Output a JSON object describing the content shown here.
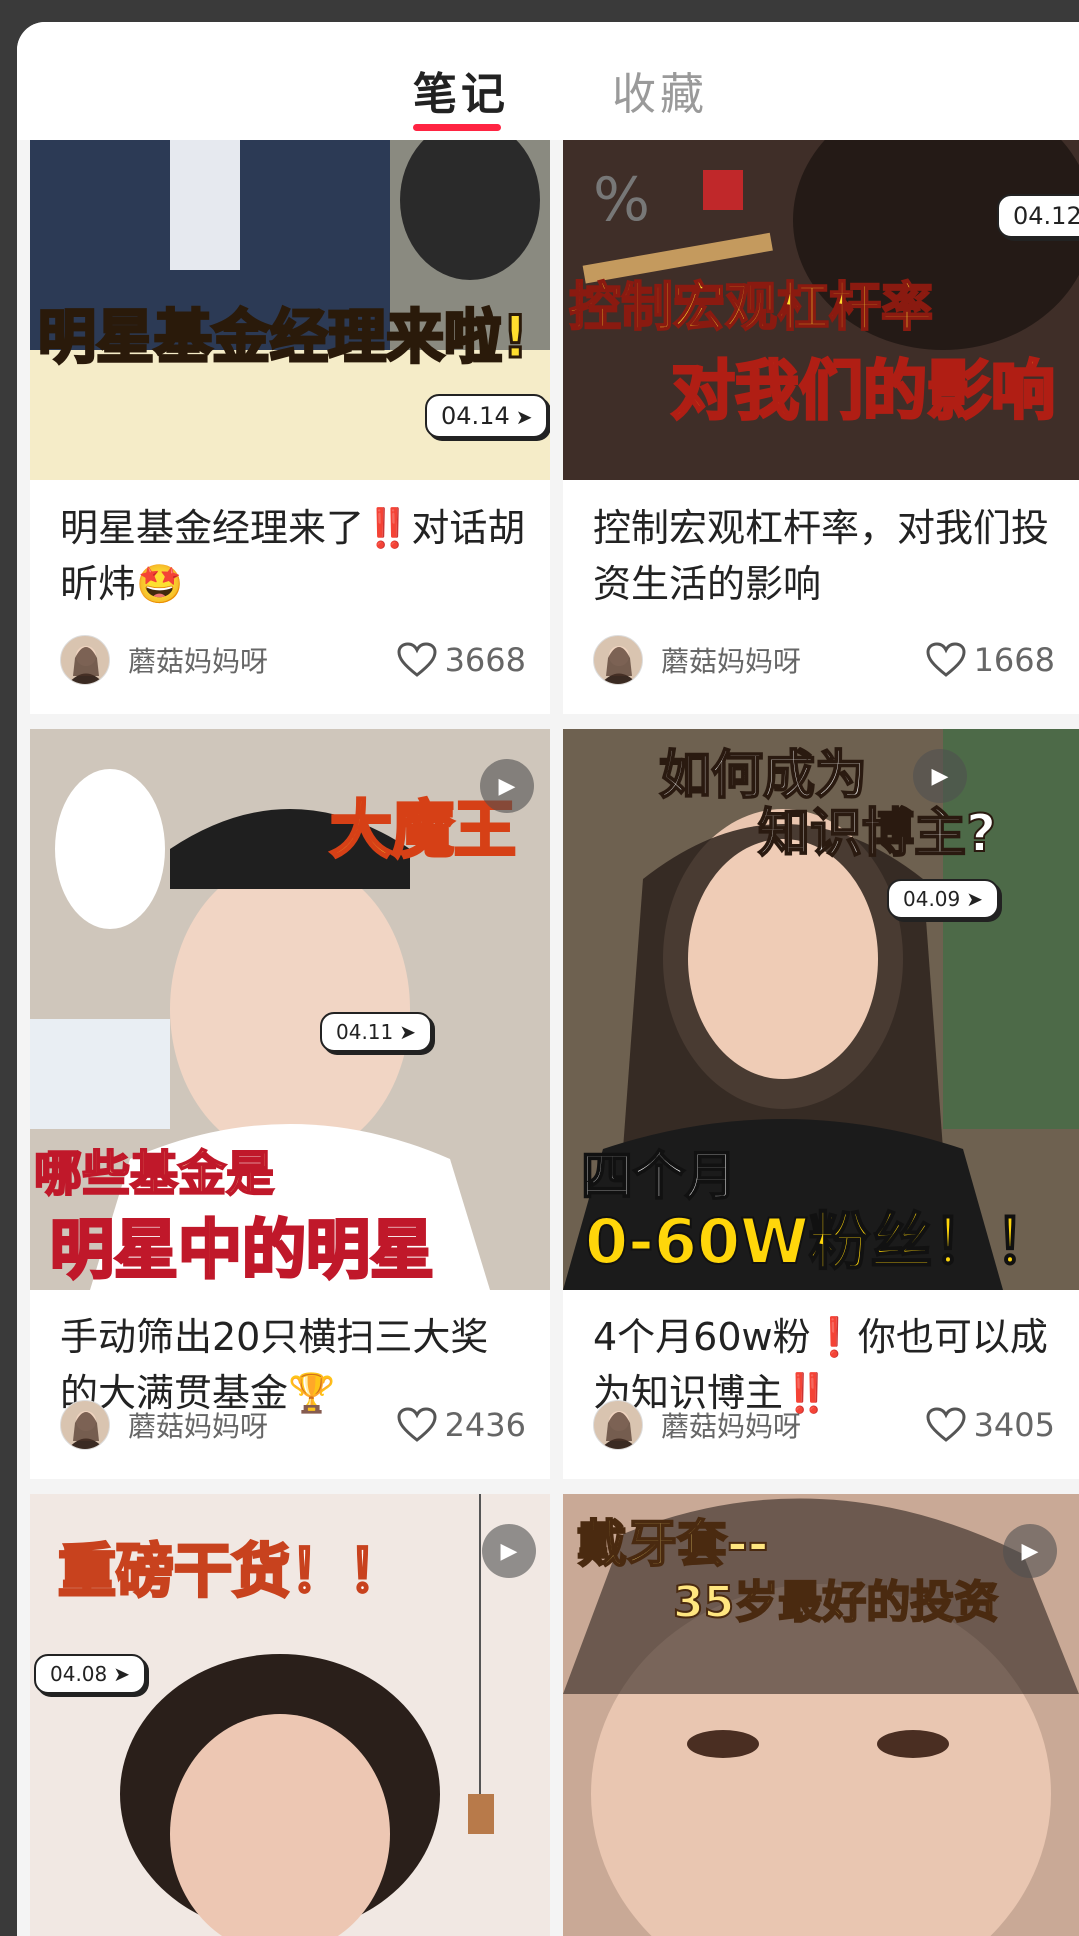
{
  "tabs": {
    "notes": "笔记",
    "favorites": "收藏"
  },
  "colors": {
    "accent": "#ff2442"
  },
  "cards": [
    {
      "overlay": [
        "明星基金经理来啦!"
      ],
      "date": "04.14",
      "title": "明星基金经理来了‼️对话胡昕炜🤩",
      "author": "蘑菇妈妈呀",
      "likes": "3668",
      "video": false
    },
    {
      "overlay": [
        "控制宏观杠杆率",
        "对我们的影响"
      ],
      "date": "04.12",
      "title": "控制宏观杠杆率，对我们投资生活的影响",
      "author": "蘑菇妈妈呀",
      "likes": "1668",
      "video": false
    },
    {
      "overlay": [
        "大魔王",
        "哪些基金是",
        "明星中的明星"
      ],
      "date": "04.11",
      "title": "手动筛出20只横扫三大奖的大满贯基金🏆",
      "author": "蘑菇妈妈呀",
      "likes": "2436",
      "video": true
    },
    {
      "overlay": [
        "如何成为",
        "知识博主?",
        "四个月",
        "0-60W粉丝！！"
      ],
      "date": "04.09",
      "title": "4个月60w粉❗️你也可以成为知识博主‼️",
      "author": "蘑菇妈妈呀",
      "likes": "3405",
      "video": true
    },
    {
      "overlay": [
        "重磅干货！！"
      ],
      "date": "04.08",
      "video": true
    },
    {
      "overlay": [
        "戴牙套--",
        "35岁最好的投资"
      ],
      "video": true
    }
  ]
}
